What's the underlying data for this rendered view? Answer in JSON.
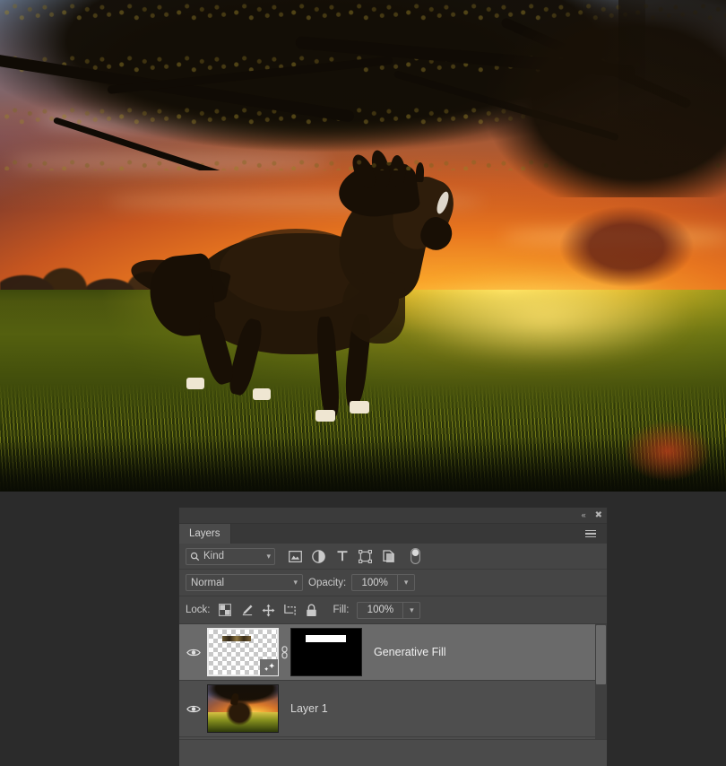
{
  "canvas": {
    "name": "document-canvas",
    "description": "Sunset landscape photo of a dark galloping horse in a golden wheat field with an overhanging tree canopy silhouette at the top"
  },
  "panel": {
    "title": "Layers",
    "topbar": {
      "collapse_icon": "double-chevron-left-icon",
      "collapse_glyph": "«",
      "close_icon": "close-icon",
      "close_glyph": "✖",
      "menu_icon": "panel-menu-icon"
    },
    "filter": {
      "search_icon": "search-icon",
      "kind_label": "Kind",
      "dropdown_icon": "chevron-down-icon",
      "icons": [
        {
          "name": "filter-pixel-layers-icon",
          "title": "Pixel layers"
        },
        {
          "name": "filter-adjustment-layers-icon",
          "title": "Adjustment layers"
        },
        {
          "name": "filter-type-layers-icon",
          "title": "Type layers"
        },
        {
          "name": "filter-shape-layers-icon",
          "title": "Shape layers"
        },
        {
          "name": "filter-smart-object-layers-icon",
          "title": "Smart objects"
        }
      ],
      "toggle_icon": "filter-toggle-switch-icon"
    },
    "blend": {
      "mode": "Normal",
      "opacity_label": "Opacity:",
      "opacity_value": "100%"
    },
    "lock": {
      "label": "Lock:",
      "fill_label": "Fill:",
      "fill_value": "100%",
      "icons": [
        {
          "name": "lock-transparent-pixels-icon",
          "title": "Lock transparent pixels"
        },
        {
          "name": "lock-image-pixels-icon",
          "title": "Lock image pixels"
        },
        {
          "name": "lock-position-icon",
          "title": "Lock position"
        },
        {
          "name": "lock-artboard-nesting-icon",
          "title": "Prevent auto-nesting"
        },
        {
          "name": "lock-all-icon",
          "title": "Lock all"
        }
      ]
    },
    "layers": [
      {
        "name": "Generative Fill",
        "visible": true,
        "selected": true,
        "thumbnail": "transparent-checkerboard-with-content-strip",
        "has_generative_badge": true,
        "has_link": true,
        "has_mask": true,
        "mask": "black-with-white-bar"
      },
      {
        "name": "Layer 1",
        "visible": true,
        "selected": false,
        "thumbnail": "horse-sunset-photo",
        "has_generative_badge": false,
        "has_link": false,
        "has_mask": false
      }
    ],
    "visibility_icon": "eye-icon",
    "link_icon": "link-chain-icon",
    "generative_badge_icon": "generative-fill-sparkle-icon"
  },
  "colors": {
    "panel_bg": "#454545",
    "list_bg": "#4e4e4e",
    "row_selected": "#6a6a6a",
    "tab_active": "#4a4a4a",
    "text": "#d4d4d4",
    "app_bg": "#2b2b2b"
  }
}
